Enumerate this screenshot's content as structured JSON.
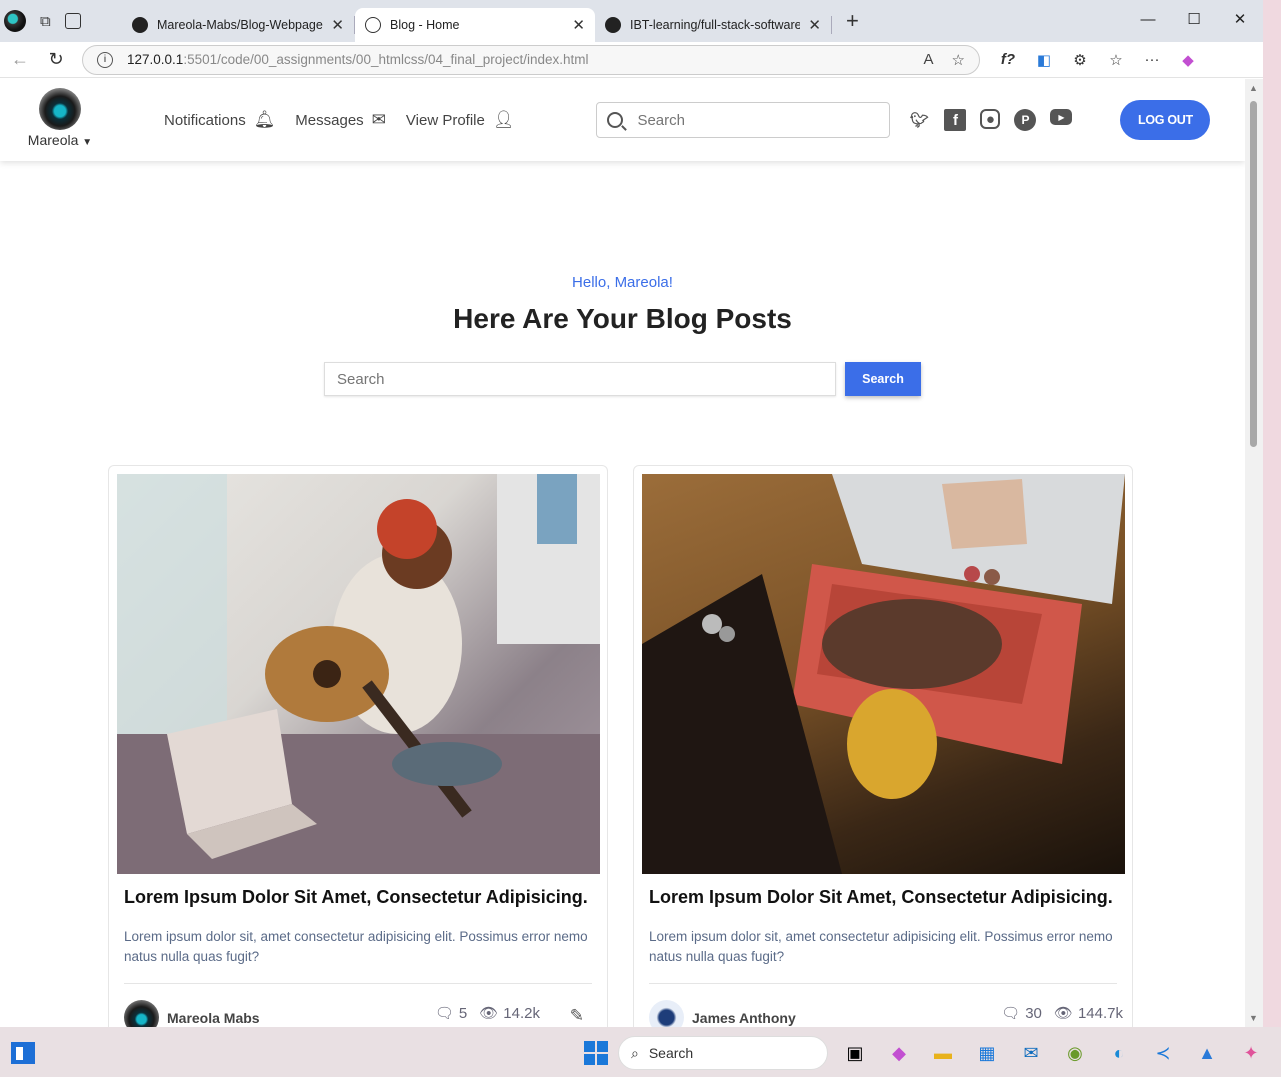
{
  "browser": {
    "tabs": [
      {
        "title": "Mareola-Mabs/Blog-Webpage: A",
        "active": false
      },
      {
        "title": "Blog - Home",
        "active": true
      },
      {
        "title": "IBT-learning/full-stack-software-e",
        "active": false
      }
    ],
    "url": {
      "host": "127.0.0.1",
      "rest": ":5501/code/00_assignments/00_htmlcss/04_final_project/index.html"
    }
  },
  "site_nav": {
    "username": "Mareola",
    "links": [
      {
        "label": "Notifications",
        "icon": "bell-icon"
      },
      {
        "label": "Messages",
        "icon": "envelope-icon"
      },
      {
        "label": "View Profile",
        "icon": "user-icon"
      }
    ],
    "search_placeholder": "Search",
    "socials": [
      "twitter-icon",
      "facebook-icon",
      "instagram-icon",
      "pinterest-icon",
      "youtube-icon"
    ],
    "logout_label": "LOG OUT"
  },
  "hero": {
    "greeting": "Hello, Mareola!",
    "title": "Here Are Your Blog Posts",
    "search_placeholder": "Search",
    "search_button": "Search"
  },
  "posts": [
    {
      "title": "Lorem Ipsum Dolor Sit Amet, Consectetur Adipisicing.",
      "excerpt": "Lorem ipsum dolor sit, amet consectetur adipisicing elit. Possimus error nemo natus nulla quas fugit?",
      "author": "Mareola Mabs",
      "comments": "5",
      "views": "14.2k",
      "editable": true
    },
    {
      "title": "Lorem Ipsum Dolor Sit Amet, Consectetur Adipisicing.",
      "excerpt": "Lorem ipsum dolor sit, amet consectetur adipisicing elit. Possimus error nemo natus nulla quas fugit?",
      "author": "James Anthony",
      "comments": "30",
      "views": "144.7k",
      "editable": false
    }
  ],
  "taskbar": {
    "search_label": "Search"
  },
  "colors": {
    "accent": "#3b6ee8",
    "excerpt": "#5b6b88"
  }
}
